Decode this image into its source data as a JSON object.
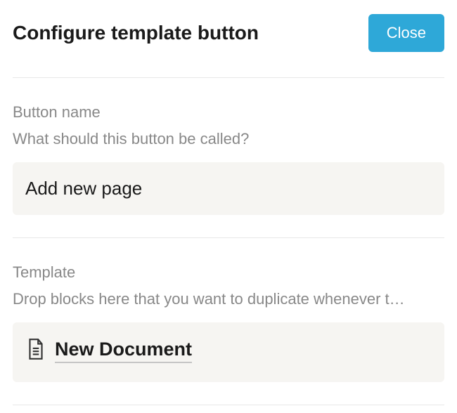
{
  "header": {
    "title": "Configure template button",
    "close_label": "Close"
  },
  "button_name": {
    "label": "Button name",
    "description": "What should this button be called?",
    "value": "Add new page"
  },
  "template": {
    "label": "Template",
    "description": "Drop blocks here that you want to duplicate whenever t…",
    "block_title": "New Document"
  }
}
